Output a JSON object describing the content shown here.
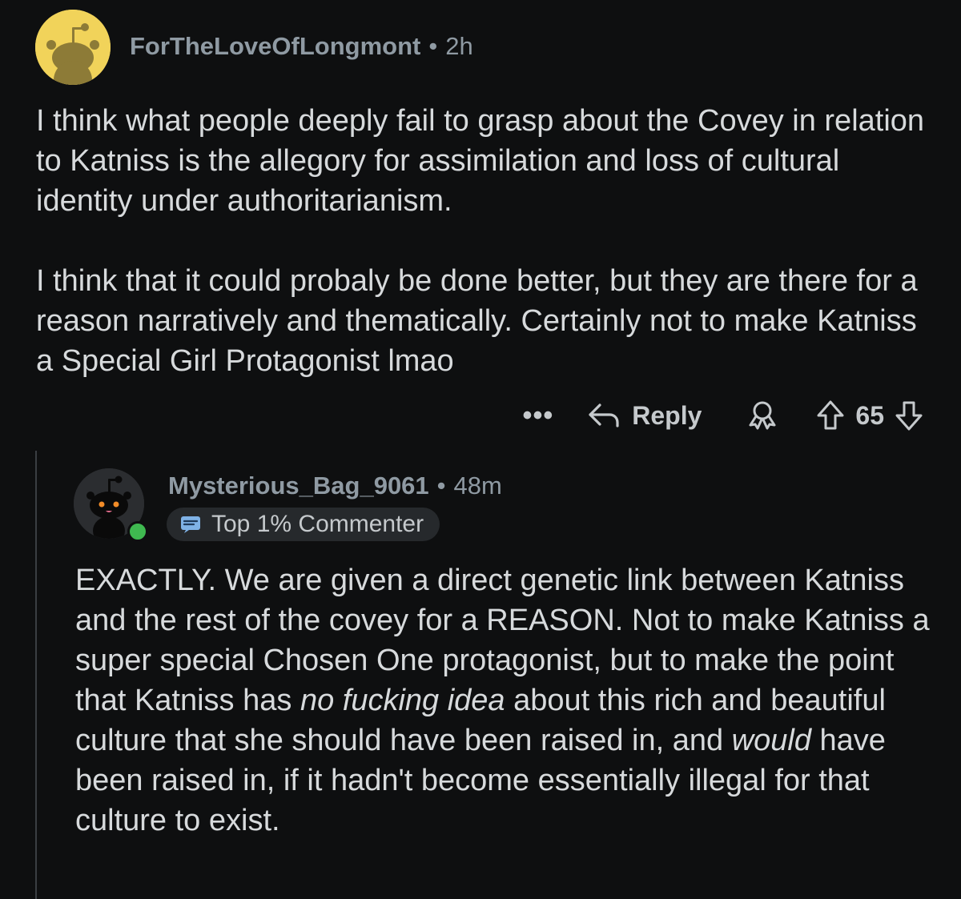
{
  "comment": {
    "username": "ForTheLoveOfLongmont",
    "separator": "•",
    "time": "2h",
    "paragraphs": [
      "I think what people deeply fail to grasp about the Covey in relation to Katniss is the allegory for assimilation and loss of cultural identity under authoritarianism.",
      "I think that it could probaly be done better, but they are there for a reason narratively and thematically. Certainly not to make Katniss a Special Girl Protagonist lmao"
    ],
    "actions": {
      "more": "•••",
      "reply": "Reply",
      "award_icon": "award-icon",
      "score": "65"
    }
  },
  "reply": {
    "username": "Mysterious_Bag_9061",
    "separator": "•",
    "time": "48m",
    "flair": "Top 1% Commenter",
    "body": {
      "part1": "EXACTLY. We are given a direct genetic link between Katniss and the rest of the covey for a REASON. Not to make Katniss a super special Chosen One protagonist, but to make the point that Katniss has ",
      "emph1": "no fucking idea",
      "part2": " about this rich and beautiful culture that she should have been raised in, and ",
      "emph2": "would",
      "part3": " have been raised in, if it hadn't become essentially illegal for that culture to exist."
    }
  },
  "colors": {
    "background": "#0e0f10",
    "text": "#d7dadc",
    "meta": "#8f9aa3",
    "avatar1": "#f1d35a",
    "online": "#3fb950"
  }
}
